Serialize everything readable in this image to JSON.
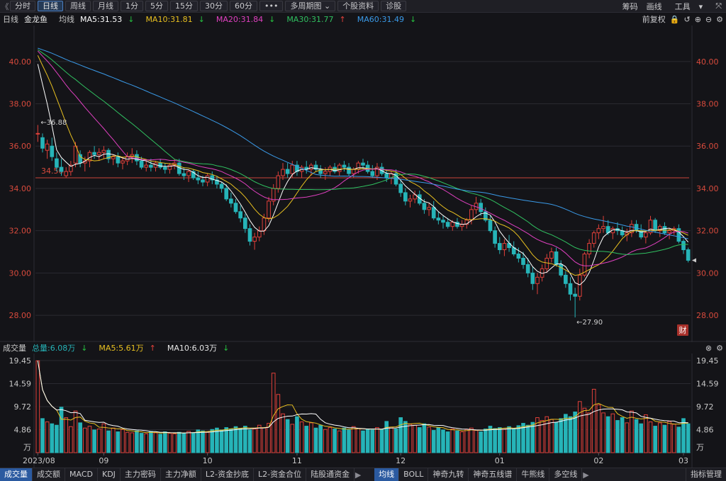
{
  "toolbar": {
    "collapse_glyph": "《",
    "periods": [
      {
        "label": "分时",
        "active": false
      },
      {
        "label": "日线",
        "active": true
      },
      {
        "label": "周线",
        "active": false
      },
      {
        "label": "月线",
        "active": false
      },
      {
        "label": "1分",
        "active": false
      },
      {
        "label": "5分",
        "active": false
      },
      {
        "label": "15分",
        "active": false
      },
      {
        "label": "30分",
        "active": false
      },
      {
        "label": "60分",
        "active": false
      },
      {
        "label": "•••",
        "active": false
      }
    ],
    "multi_period_label": "多周期图",
    "profile_label": "个股资料",
    "diagnose_label": "诊股",
    "chips_label": "筹码",
    "draw_label": "画线",
    "tools_label": "工具"
  },
  "legend": {
    "period": "日线",
    "stock_name": "金龙鱼",
    "avg_label": "均线",
    "ma5": "MA5:31.53",
    "ma10": "MA10:31.81",
    "ma20": "MA20:31.84",
    "ma30": "MA30:31.77",
    "ma60": "MA60:31.49",
    "ma5_arrow": "↓",
    "ma10_arrow": "↓",
    "ma20_arrow": "↓",
    "ma30_arrow": "↑",
    "ma60_arrow": "↓",
    "adjust_label": "前复权"
  },
  "volume_legend": {
    "title": "成交量",
    "total": "总量:6.08万",
    "total_arrow": "↓",
    "ma5": "MA5:5.61万",
    "ma5_arrow": "↑",
    "ma10": "MA10:6.03万",
    "ma10_arrow": "↓"
  },
  "annotations": {
    "high_label": "←36.88",
    "low_label": "←27.90",
    "hline_label": "34.50",
    "fin_badge": "财"
  },
  "colors": {
    "up": "#e0403a",
    "down": "#26b4b8",
    "ma5": "#ffffff",
    "ma10": "#e8c020",
    "ma20": "#e040c0",
    "ma30": "#30c060",
    "ma60": "#3a9ae8",
    "axis_text": "#d84a3c",
    "grid": "#2a2a30"
  },
  "bottom_tabs": {
    "left": [
      {
        "label": "成交量",
        "active": true
      },
      {
        "label": "成交额",
        "active": false
      },
      {
        "label": "MACD",
        "active": false
      },
      {
        "label": "KDJ",
        "active": false
      },
      {
        "label": "主力密码",
        "active": false
      },
      {
        "label": "主力净额",
        "active": false
      },
      {
        "label": "L2-资金抄底",
        "active": false
      },
      {
        "label": "L2-资金合位",
        "active": false
      },
      {
        "label": "陆股通资金",
        "active": false
      }
    ],
    "right": [
      {
        "label": "均线",
        "active": true
      },
      {
        "label": "BOLL",
        "active": false
      },
      {
        "label": "神奇九转",
        "active": false
      },
      {
        "label": "神奇五线谱",
        "active": false
      },
      {
        "label": "牛熊线",
        "active": false
      },
      {
        "label": "多空线",
        "active": false
      }
    ],
    "more_glyph": "▶",
    "indicator_manage": "指标管理"
  },
  "chart_data": [
    {
      "type": "candlestick",
      "title": "",
      "y_ticks": [
        "40.00",
        "38.00",
        "36.00",
        "34.00",
        "32.00",
        "30.00",
        "28.00"
      ],
      "y_tick_values": [
        40,
        38,
        36,
        34,
        32,
        30,
        28
      ],
      "ylim": [
        27.3,
        41.3
      ],
      "x_labels": [
        "2023/08",
        "09",
        "10",
        "11",
        "12",
        "01",
        "02",
        "03"
      ],
      "x_label_index": [
        0,
        14,
        36,
        55,
        77,
        98,
        119,
        137
      ],
      "horizontal_line": 34.5,
      "marked_high": 36.88,
      "marked_low": 27.9,
      "series_names": [
        "MA5",
        "MA10",
        "MA20",
        "MA30",
        "MA60"
      ],
      "ohlc": [
        [
          36.6,
          37.0,
          36.2,
          36.6
        ],
        [
          36.4,
          36.6,
          35.7,
          35.9
        ],
        [
          35.8,
          36.3,
          35.4,
          36.1
        ],
        [
          36.0,
          36.4,
          35.3,
          35.5
        ],
        [
          35.4,
          35.7,
          34.8,
          35.0
        ],
        [
          35.0,
          35.4,
          34.6,
          34.8
        ],
        [
          34.6,
          35.0,
          34.5,
          34.8
        ],
        [
          34.8,
          35.3,
          34.6,
          35.1
        ],
        [
          35.2,
          36.2,
          35.0,
          36.0
        ],
        [
          35.6,
          35.8,
          35.0,
          35.2
        ],
        [
          35.2,
          35.5,
          34.8,
          35.3
        ],
        [
          35.3,
          35.8,
          35.0,
          35.7
        ],
        [
          35.7,
          36.0,
          35.4,
          35.6
        ],
        [
          35.6,
          35.9,
          35.3,
          35.7
        ],
        [
          35.7,
          36.0,
          35.4,
          35.8
        ],
        [
          35.8,
          35.9,
          35.2,
          35.4
        ],
        [
          35.4,
          35.6,
          35.1,
          35.5
        ],
        [
          35.5,
          35.7,
          35.0,
          35.2
        ],
        [
          35.2,
          35.5,
          34.9,
          35.3
        ],
        [
          35.3,
          35.7,
          35.1,
          35.5
        ],
        [
          35.5,
          35.9,
          35.2,
          35.6
        ],
        [
          35.6,
          35.8,
          35.1,
          35.3
        ],
        [
          35.3,
          35.5,
          34.9,
          35.0
        ],
        [
          35.0,
          35.3,
          34.8,
          35.1
        ],
        [
          35.1,
          35.4,
          34.8,
          35.0
        ],
        [
          35.0,
          35.3,
          34.8,
          35.2
        ],
        [
          35.2,
          35.4,
          34.9,
          35.0
        ],
        [
          35.0,
          35.2,
          34.7,
          34.9
        ],
        [
          34.9,
          35.2,
          34.7,
          35.1
        ],
        [
          35.1,
          35.4,
          34.9,
          35.2
        ],
        [
          35.2,
          35.4,
          34.6,
          34.7
        ],
        [
          34.7,
          35.0,
          34.4,
          34.6
        ],
        [
          34.6,
          34.9,
          34.3,
          34.8
        ],
        [
          34.8,
          34.9,
          34.4,
          34.5
        ],
        [
          34.5,
          34.8,
          34.2,
          34.4
        ],
        [
          34.4,
          34.6,
          34.1,
          34.3
        ],
        [
          34.3,
          34.7,
          34.1,
          34.6
        ],
        [
          34.6,
          34.8,
          34.2,
          34.4
        ],
        [
          34.4,
          34.6,
          34.0,
          34.2
        ],
        [
          34.2,
          34.3,
          33.8,
          34.0
        ],
        [
          34.0,
          34.2,
          33.4,
          33.5
        ],
        [
          33.5,
          33.8,
          33.1,
          33.3
        ],
        [
          33.3,
          33.5,
          32.8,
          32.9
        ],
        [
          32.9,
          33.2,
          32.4,
          32.6
        ],
        [
          32.6,
          32.8,
          31.9,
          32.1
        ],
        [
          32.1,
          32.3,
          31.3,
          31.5
        ],
        [
          31.5,
          31.9,
          31.1,
          31.7
        ],
        [
          31.7,
          32.2,
          31.5,
          32.0
        ],
        [
          32.0,
          32.8,
          31.8,
          32.6
        ],
        [
          32.6,
          33.6,
          32.4,
          33.4
        ],
        [
          33.4,
          34.2,
          33.2,
          34.0
        ],
        [
          34.0,
          34.8,
          33.8,
          34.6
        ],
        [
          34.6,
          35.2,
          34.4,
          34.9
        ],
        [
          34.9,
          35.2,
          34.5,
          34.7
        ],
        [
          34.7,
          35.3,
          34.5,
          35.1
        ],
        [
          35.1,
          35.3,
          34.6,
          34.8
        ],
        [
          34.8,
          35.1,
          34.5,
          35.0
        ],
        [
          35.0,
          35.3,
          34.7,
          34.9
        ],
        [
          34.9,
          35.2,
          34.6,
          35.1
        ],
        [
          35.1,
          35.3,
          34.8,
          34.9
        ],
        [
          34.9,
          35.1,
          34.5,
          34.7
        ],
        [
          34.7,
          35.0,
          34.4,
          34.8
        ],
        [
          34.8,
          35.1,
          34.6,
          35.0
        ],
        [
          35.0,
          35.2,
          34.7,
          34.8
        ],
        [
          34.8,
          35.2,
          34.6,
          35.1
        ],
        [
          35.1,
          35.3,
          34.8,
          35.0
        ],
        [
          35.0,
          35.2,
          34.6,
          34.7
        ],
        [
          34.7,
          35.0,
          34.5,
          34.9
        ],
        [
          34.9,
          35.3,
          34.7,
          35.2
        ],
        [
          35.2,
          35.4,
          34.9,
          35.1
        ],
        [
          35.1,
          35.3,
          34.7,
          34.8
        ],
        [
          34.8,
          35.1,
          34.5,
          34.6
        ],
        [
          34.6,
          35.2,
          34.4,
          35.0
        ],
        [
          35.0,
          35.2,
          34.6,
          34.7
        ],
        [
          34.7,
          34.9,
          34.3,
          34.5
        ],
        [
          34.5,
          34.8,
          34.2,
          34.7
        ],
        [
          34.7,
          34.9,
          34.1,
          34.2
        ],
        [
          34.2,
          34.4,
          33.6,
          33.8
        ],
        [
          33.8,
          34.0,
          33.2,
          33.4
        ],
        [
          33.4,
          33.7,
          33.1,
          33.5
        ],
        [
          33.5,
          33.9,
          33.3,
          33.7
        ],
        [
          33.7,
          33.9,
          33.2,
          33.3
        ],
        [
          33.3,
          33.5,
          32.8,
          33.0
        ],
        [
          33.0,
          33.3,
          32.7,
          33.1
        ],
        [
          33.1,
          33.4,
          32.5,
          32.6
        ],
        [
          32.6,
          32.9,
          32.3,
          32.5
        ],
        [
          32.5,
          32.7,
          32.1,
          32.4
        ],
        [
          32.4,
          32.6,
          32.1,
          32.2
        ],
        [
          32.2,
          32.5,
          32.0,
          32.4
        ],
        [
          32.4,
          32.6,
          32.1,
          32.2
        ],
        [
          32.2,
          32.5,
          32.0,
          32.3
        ],
        [
          32.3,
          32.6,
          32.1,
          32.5
        ],
        [
          32.5,
          33.2,
          32.3,
          33.0
        ],
        [
          33.0,
          33.6,
          32.8,
          33.3
        ],
        [
          33.3,
          33.5,
          32.7,
          32.9
        ],
        [
          32.9,
          33.1,
          32.4,
          32.5
        ],
        [
          32.5,
          32.7,
          31.9,
          32.0
        ],
        [
          32.0,
          32.2,
          31.2,
          31.4
        ],
        [
          31.4,
          31.7,
          30.9,
          31.1
        ],
        [
          31.1,
          31.6,
          30.8,
          31.4
        ],
        [
          31.4,
          31.8,
          31.0,
          31.2
        ],
        [
          31.2,
          31.5,
          30.8,
          30.9
        ],
        [
          30.9,
          31.2,
          30.5,
          30.7
        ],
        [
          30.7,
          31.0,
          30.2,
          30.4
        ],
        [
          30.4,
          30.7,
          29.8,
          30.0
        ],
        [
          30.0,
          30.3,
          29.2,
          29.5
        ],
        [
          29.5,
          30.0,
          29.0,
          29.8
        ],
        [
          29.8,
          30.4,
          29.6,
          30.2
        ],
        [
          30.2,
          30.9,
          30.0,
          30.7
        ],
        [
          30.7,
          31.2,
          30.5,
          31.0
        ],
        [
          31.0,
          31.2,
          30.3,
          30.4
        ],
        [
          30.4,
          30.6,
          29.8,
          29.9
        ],
        [
          29.9,
          30.1,
          29.3,
          29.5
        ],
        [
          29.5,
          29.8,
          28.7,
          29.0
        ],
        [
          29.0,
          29.3,
          27.9,
          28.9
        ],
        [
          28.9,
          30.2,
          28.7,
          29.9
        ],
        [
          29.9,
          31.0,
          29.8,
          30.9
        ],
        [
          30.9,
          31.6,
          30.7,
          31.4
        ],
        [
          31.4,
          32.0,
          31.2,
          31.9
        ],
        [
          31.9,
          32.3,
          31.6,
          32.1
        ],
        [
          32.1,
          32.7,
          31.9,
          32.2
        ],
        [
          32.2,
          32.5,
          31.8,
          31.9
        ],
        [
          31.9,
          32.2,
          31.6,
          32.1
        ],
        [
          32.1,
          32.4,
          31.8,
          32.0
        ],
        [
          32.0,
          32.2,
          31.7,
          31.8
        ],
        [
          31.8,
          32.1,
          31.5,
          31.9
        ],
        [
          31.9,
          32.5,
          31.7,
          32.3
        ],
        [
          32.3,
          32.5,
          31.9,
          32.0
        ],
        [
          32.0,
          32.3,
          31.6,
          31.7
        ],
        [
          31.7,
          32.0,
          31.4,
          31.9
        ],
        [
          31.9,
          32.7,
          31.8,
          32.5
        ],
        [
          32.5,
          32.6,
          31.9,
          32.0
        ],
        [
          32.0,
          32.3,
          31.7,
          32.2
        ],
        [
          32.2,
          32.4,
          31.8,
          31.9
        ],
        [
          31.9,
          32.1,
          31.6,
          32.0
        ],
        [
          32.0,
          32.2,
          31.8,
          32.1
        ],
        [
          32.1,
          32.3,
          31.4,
          31.5
        ],
        [
          31.5,
          31.6,
          30.9,
          31.1
        ],
        [
          31.1,
          31.2,
          30.5,
          30.6
        ]
      ]
    },
    {
      "type": "bar",
      "title": "",
      "unit": "万",
      "y_ticks": [
        "19.45",
        "14.59",
        "9.72",
        "4.86"
      ],
      "y_tick_values": [
        19.45,
        14.59,
        9.72,
        4.86
      ],
      "ylim": [
        0,
        19.45
      ],
      "series_names": [
        "MA5",
        "MA10"
      ],
      "values": [
        19.4,
        7.2,
        6.5,
        6.1,
        5.8,
        9.6,
        7.4,
        5.5,
        8.8,
        6.3,
        5.2,
        5.6,
        4.8,
        5.0,
        6.1,
        4.6,
        5.2,
        4.4,
        4.9,
        4.3,
        4.2,
        4.6,
        4.1,
        4.0,
        4.5,
        4.2,
        3.9,
        4.4,
        4.1,
        4.0,
        4.3,
        4.1,
        4.5,
        4.2,
        4.8,
        4.6,
        4.3,
        4.9,
        5.2,
        4.8,
        5.3,
        5.0,
        5.5,
        5.1,
        5.6,
        4.8,
        5.0,
        5.8,
        5.3,
        6.2,
        16.8,
        12.3,
        8.2,
        7.0,
        6.0,
        7.6,
        6.5,
        5.6,
        6.3,
        5.2,
        5.8,
        4.9,
        5.3,
        5.0,
        4.6,
        5.2,
        4.8,
        5.5,
        5.1,
        4.6,
        5.0,
        4.8,
        5.3,
        4.9,
        6.6,
        5.4,
        5.0,
        7.4,
        6.6,
        6.0,
        5.8,
        5.3,
        6.1,
        5.4,
        4.7,
        5.3,
        4.8,
        4.4,
        5.0,
        4.6,
        4.4,
        4.9,
        5.2,
        4.7,
        4.4,
        5.0,
        5.6,
        5.1,
        5.3,
        4.9,
        5.5,
        5.0,
        5.7,
        6.2,
        5.8,
        6.4,
        7.4,
        6.8,
        7.6,
        7.0,
        6.4,
        7.2,
        8.1,
        7.6,
        8.6,
        10.8,
        9.4,
        8.4,
        13.4,
        10.1,
        8.4,
        7.6,
        8.2,
        6.8,
        7.4,
        6.3,
        8.8,
        7.0,
        6.1,
        8.0,
        6.5,
        5.6,
        6.3,
        5.8,
        6.6,
        6.0,
        5.4,
        7.2,
        6.1
      ]
    }
  ]
}
